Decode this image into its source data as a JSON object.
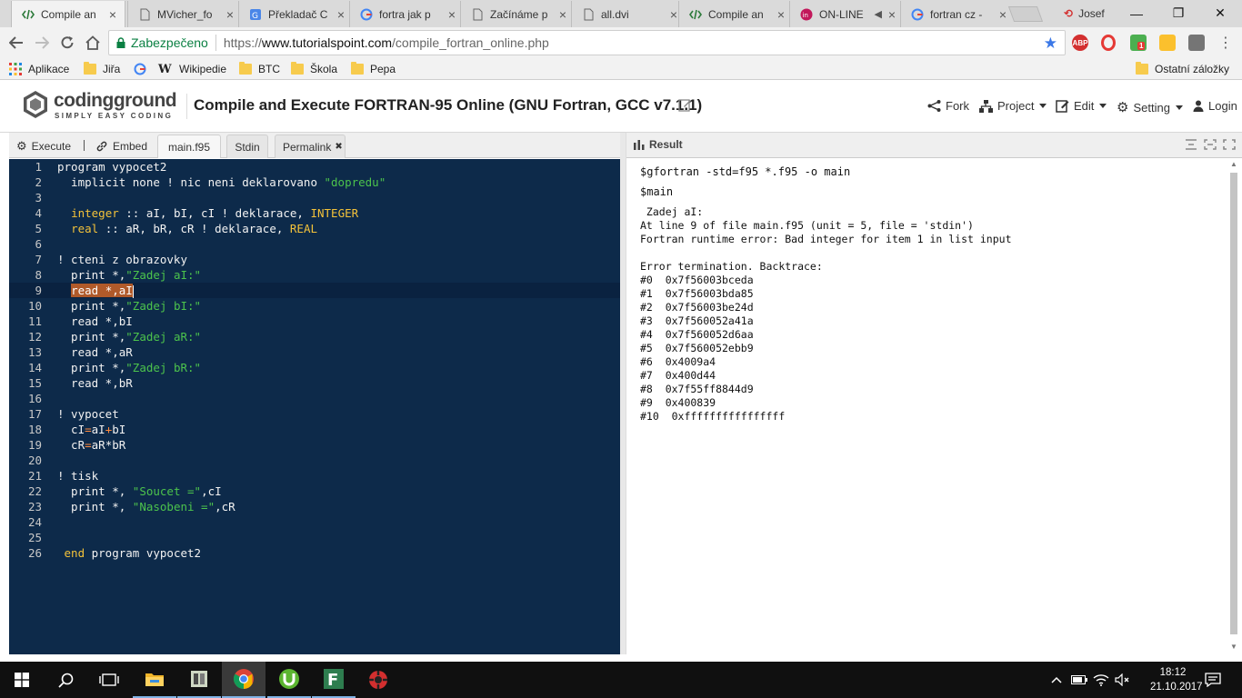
{
  "browser": {
    "tabs": [
      {
        "title": "Compile an",
        "active": true,
        "icon": "code-icon"
      },
      {
        "title": "MVicher_fo",
        "active": false,
        "icon": "doc-icon"
      },
      {
        "title": "Překladač C",
        "active": false,
        "icon": "gdocs-icon"
      },
      {
        "title": "fortra jak p",
        "active": false,
        "icon": "google-icon"
      },
      {
        "title": "Začínáme p",
        "active": false,
        "icon": "doc-icon"
      },
      {
        "title": "all.dvi",
        "active": false,
        "icon": "doc-icon"
      },
      {
        "title": "Compile an",
        "active": false,
        "icon": "code-icon"
      },
      {
        "title": "ON-LINE",
        "active": false,
        "icon": "in-icon"
      },
      {
        "title": "fortran cz -",
        "active": false,
        "icon": "google-icon"
      }
    ],
    "profile_name": "Josef",
    "secure_label": "Zabezpečeno",
    "url_scheme": "https://",
    "url_host": "www.tutorialspoint.com",
    "url_path": "/compile_fortran_online.php",
    "ext_badge": "1",
    "bookmarks": [
      {
        "label": "Aplikace",
        "icon": "apps-grid-icon"
      },
      {
        "label": "Jiřa",
        "icon": "folder-icon"
      },
      {
        "label": "",
        "icon": "google-icon"
      },
      {
        "label": "Wikipedie",
        "icon": "wikipedia-icon"
      },
      {
        "label": "BTC",
        "icon": "folder-icon"
      },
      {
        "label": "Škola",
        "icon": "folder-icon"
      },
      {
        "label": "Pepa",
        "icon": "folder-icon"
      }
    ],
    "other_bookmarks": "Ostatní záložky"
  },
  "site": {
    "logo_main": "codingground",
    "logo_sub": "SIMPLY EASY CODING",
    "page_title": "Compile and Execute FORTRAN-95 Online (GNU Fortran, GCC v7.1.1)",
    "menu": {
      "fork": "Fork",
      "project": "Project",
      "edit": "Edit",
      "setting": "Setting",
      "login": "Login"
    }
  },
  "editor": {
    "execute_label": "Execute",
    "embed_label": "Embed",
    "file_tab": "main.f95",
    "stdin_tab": "Stdin",
    "permalink_tab": "Permalink",
    "lines": [
      "1",
      "2",
      "3",
      "4",
      "5",
      "6",
      "7",
      "8",
      "9",
      "10",
      "11",
      "12",
      "13",
      "14",
      "15",
      "16",
      "17",
      "18",
      "19",
      "20",
      "21",
      "22",
      "23",
      "24",
      "25",
      "26"
    ],
    "code": {
      "l1": "program vypocet2",
      "l2a": "  implicit none ! nic neni deklarovano ",
      "l2b": "\"dopredu\"",
      "l4a": "  ",
      "l4b": "integer",
      "l4c": " :: aI, bI, cI ! deklarace, ",
      "l4d": "INTEGER",
      "l5a": "  ",
      "l5b": "real",
      "l5c": " :: aR, bR, cR ! deklarace, ",
      "l5d": "REAL",
      "l7": "! cteni z obrazovky",
      "l8a": "  print *,",
      "l8b": "\"Zadej aI:\"",
      "l9a": "  ",
      "l9b": "read *,aI",
      "l10a": "  print *,",
      "l10b": "\"Zadej bI:\"",
      "l11": "  read *,bI",
      "l12a": "  print *,",
      "l12b": "\"Zadej aR:\"",
      "l13": "  read *,aR",
      "l14a": "  print *,",
      "l14b": "\"Zadej bR:\"",
      "l15": "  read *,bR",
      "l17": "! vypocet",
      "l18a": "  cI",
      "l18b": "=",
      "l18c": "aI",
      "l18d": "+",
      "l18e": "bI",
      "l19a": "  cR",
      "l19b": "=",
      "l19c": "aR*bR",
      "l21": "! tisk",
      "l22a": "  print *, ",
      "l22b": "\"Soucet =\"",
      "l22c": ",cI",
      "l23a": "  print *, ",
      "l23b": "\"Nasobeni =\"",
      "l23c": ",cR",
      "l26a": " ",
      "l26b": "end",
      "l26c": " program vypocet2"
    }
  },
  "result": {
    "title": "Result",
    "command": "$gfortran -std=f95 *.f95 -o main",
    "run": "$main",
    "output_lines": [
      " Zadej aI:",
      "At line 9 of file main.f95 (unit = 5, file = 'stdin')",
      "Fortran runtime error: Bad integer for item 1 in list input",
      "",
      "Error termination. Backtrace:",
      "#0  0x7f56003bceda",
      "#1  0x7f56003bda85",
      "#2  0x7f56003be24d",
      "#3  0x7f560052a41a",
      "#4  0x7f560052d6aa",
      "#5  0x7f560052ebb9",
      "#6  0x4009a4",
      "#7  0x400d44",
      "#8  0x7f55ff8844d9",
      "#9  0x400839",
      "#10  0xffffffffffffffff"
    ]
  },
  "taskbar": {
    "time": "18:12",
    "date": "21.10.2017",
    "apps": [
      "start-icon",
      "search-icon",
      "task-view-icon",
      "file-explorer-icon",
      "app-icon",
      "chrome-icon",
      "utorrent-icon",
      "f-app-icon",
      "red-app-icon"
    ]
  },
  "colors": {
    "editor_bg": "#0d2a4a",
    "keyword": "#f3c23a",
    "string": "#4cc34c",
    "secure_green": "#0b8043"
  }
}
